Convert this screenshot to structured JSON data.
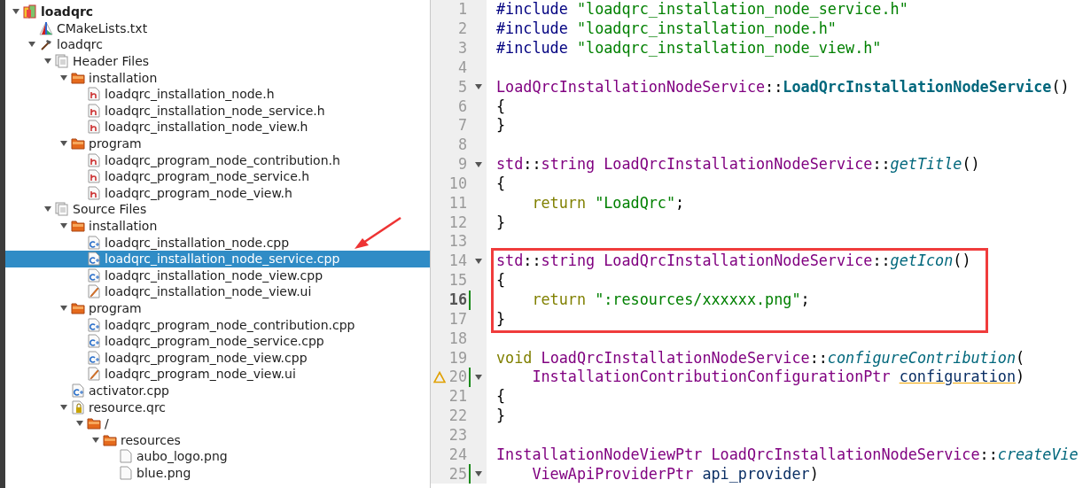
{
  "project_tree": {
    "items": [
      {
        "label": "loadqrc",
        "kind": "project",
        "bold": true,
        "expanded": true,
        "selected": false,
        "children": [
          {
            "label": "CMakeLists.txt",
            "kind": "cmake",
            "selected": false
          },
          {
            "label": "loadqrc",
            "kind": "build",
            "expanded": true,
            "selected": false,
            "children": [
              {
                "label": "Header Files",
                "kind": "group",
                "expanded": true,
                "selected": false,
                "children": [
                  {
                    "label": "installation",
                    "kind": "folder",
                    "expanded": true,
                    "selected": false,
                    "children": [
                      {
                        "label": "loadqrc_installation_node.h",
                        "kind": "header",
                        "selected": false
                      },
                      {
                        "label": "loadqrc_installation_node_service.h",
                        "kind": "header",
                        "selected": false
                      },
                      {
                        "label": "loadqrc_installation_node_view.h",
                        "kind": "header",
                        "selected": false
                      }
                    ]
                  },
                  {
                    "label": "program",
                    "kind": "folder",
                    "expanded": true,
                    "selected": false,
                    "children": [
                      {
                        "label": "loadqrc_program_node_contribution.h",
                        "kind": "header",
                        "selected": false
                      },
                      {
                        "label": "loadqrc_program_node_service.h",
                        "kind": "header",
                        "selected": false
                      },
                      {
                        "label": "loadqrc_program_node_view.h",
                        "kind": "header",
                        "selected": false
                      }
                    ]
                  }
                ]
              },
              {
                "label": "Source Files",
                "kind": "group",
                "expanded": true,
                "selected": false,
                "children": [
                  {
                    "label": "installation",
                    "kind": "folder",
                    "expanded": true,
                    "selected": false,
                    "children": [
                      {
                        "label": "loadqrc_installation_node.cpp",
                        "kind": "source",
                        "selected": false
                      },
                      {
                        "label": "loadqrc_installation_node_service.cpp",
                        "kind": "source",
                        "selected": true
                      },
                      {
                        "label": "loadqrc_installation_node_view.cpp",
                        "kind": "source",
                        "selected": false
                      },
                      {
                        "label": "loadqrc_installation_node_view.ui",
                        "kind": "form",
                        "selected": false
                      }
                    ]
                  },
                  {
                    "label": "program",
                    "kind": "folder",
                    "expanded": true,
                    "selected": false,
                    "children": [
                      {
                        "label": "loadqrc_program_node_contribution.cpp",
                        "kind": "source",
                        "selected": false
                      },
                      {
                        "label": "loadqrc_program_node_service.cpp",
                        "kind": "source",
                        "selected": false
                      },
                      {
                        "label": "loadqrc_program_node_view.cpp",
                        "kind": "source",
                        "selected": false
                      },
                      {
                        "label": "loadqrc_program_node_view.ui",
                        "kind": "form",
                        "selected": false
                      }
                    ]
                  },
                  {
                    "label": "activator.cpp",
                    "kind": "source",
                    "selected": false
                  },
                  {
                    "label": "resource.qrc",
                    "kind": "qrc",
                    "expanded": true,
                    "selected": false,
                    "children": [
                      {
                        "label": "/",
                        "kind": "folder",
                        "expanded": true,
                        "selected": false,
                        "children": [
                          {
                            "label": "resources",
                            "kind": "folder",
                            "expanded": true,
                            "selected": false,
                            "children": [
                              {
                                "label": "aubo_logo.png",
                                "kind": "file",
                                "selected": false
                              },
                              {
                                "label": "blue.png",
                                "kind": "file",
                                "selected": false
                              }
                            ]
                          }
                        ]
                      }
                    ]
                  }
                ]
              }
            ]
          }
        ]
      }
    ]
  },
  "editor": {
    "lines": [
      {
        "number": "1",
        "tokens": [
          {
            "text": "#include ",
            "kind": "preproc"
          },
          {
            "text": "\"loadqrc_installation_node_service.h\"",
            "kind": "string"
          }
        ]
      },
      {
        "number": "2",
        "tokens": [
          {
            "text": "#include ",
            "kind": "preproc"
          },
          {
            "text": "\"loadqrc_installation_node.h\"",
            "kind": "string"
          }
        ]
      },
      {
        "number": "3",
        "tokens": [
          {
            "text": "#include ",
            "kind": "preproc"
          },
          {
            "text": "\"loadqrc_installation_node_view.h\"",
            "kind": "string"
          }
        ]
      },
      {
        "number": "4"
      },
      {
        "number": "5",
        "foldable": true,
        "tokens": [
          {
            "text": "LoadQrcInstallationNodeService",
            "kind": "type"
          },
          {
            "text": "::",
            "kind": "plain"
          },
          {
            "text": "LoadQrcInstallationNodeService",
            "kind": "declaration"
          },
          {
            "text": "()",
            "kind": "plain"
          }
        ]
      },
      {
        "number": "6",
        "tokens": [
          {
            "text": "{",
            "kind": "plain"
          }
        ]
      },
      {
        "number": "7",
        "tokens": [
          {
            "text": "}",
            "kind": "plain"
          }
        ]
      },
      {
        "number": "8"
      },
      {
        "number": "9",
        "foldable": true,
        "tokens": [
          {
            "text": "std",
            "kind": "type"
          },
          {
            "text": "::",
            "kind": "plain"
          },
          {
            "text": "string ",
            "kind": "type"
          },
          {
            "text": "LoadQrcInstallationNodeService",
            "kind": "type"
          },
          {
            "text": "::",
            "kind": "plain"
          },
          {
            "text": "getTitle",
            "kind": "function"
          },
          {
            "text": "()",
            "kind": "plain"
          }
        ]
      },
      {
        "number": "10",
        "tokens": [
          {
            "text": "{",
            "kind": "plain"
          }
        ]
      },
      {
        "number": "11",
        "tokens": [
          {
            "text": "    return ",
            "kind": "keyword"
          },
          {
            "text": "\"LoadQrc\"",
            "kind": "string"
          },
          {
            "text": ";",
            "kind": "plain"
          }
        ]
      },
      {
        "number": "12",
        "tokens": [
          {
            "text": "}",
            "kind": "plain"
          }
        ]
      },
      {
        "number": "13"
      },
      {
        "number": "14",
        "foldable": true,
        "boxed": true,
        "tokens": [
          {
            "text": "std",
            "kind": "type"
          },
          {
            "text": "::",
            "kind": "plain"
          },
          {
            "text": "string ",
            "kind": "type"
          },
          {
            "text": "LoadQrcInstallationNodeService",
            "kind": "type"
          },
          {
            "text": "::",
            "kind": "plain"
          },
          {
            "text": "getIcon",
            "kind": "function"
          },
          {
            "text": "()",
            "kind": "plain"
          }
        ]
      },
      {
        "number": "15",
        "boxed": true,
        "tokens": [
          {
            "text": "{",
            "kind": "plain"
          }
        ]
      },
      {
        "number": "16",
        "boxed": true,
        "current": true,
        "changed": true,
        "tokens": [
          {
            "text": "    return ",
            "kind": "keyword"
          },
          {
            "text": "\":resources/xxxxxx.png\"",
            "kind": "string"
          },
          {
            "text": ";",
            "kind": "plain"
          }
        ]
      },
      {
        "number": "17",
        "boxed": true,
        "tokens": [
          {
            "text": "}",
            "kind": "plain"
          }
        ]
      },
      {
        "number": "18"
      },
      {
        "number": "19",
        "tokens": [
          {
            "text": "void ",
            "kind": "keyword"
          },
          {
            "text": "LoadQrcInstallationNodeService",
            "kind": "type"
          },
          {
            "text": "::",
            "kind": "plain"
          },
          {
            "text": "configureContribution",
            "kind": "function"
          },
          {
            "text": "(",
            "kind": "plain"
          }
        ]
      },
      {
        "number": "20",
        "foldable": true,
        "changed": true,
        "warning": true,
        "tokens": [
          {
            "text": "    InstallationContributionConfigurationPtr ",
            "kind": "type"
          },
          {
            "text": "configuration",
            "kind": "unused"
          },
          {
            "text": ")",
            "kind": "plain"
          }
        ]
      },
      {
        "number": "21",
        "tokens": [
          {
            "text": "{",
            "kind": "plain"
          }
        ]
      },
      {
        "number": "22",
        "tokens": [
          {
            "text": "}",
            "kind": "plain"
          }
        ]
      },
      {
        "number": "23"
      },
      {
        "number": "24",
        "tokens": [
          {
            "text": "InstallationNodeViewPtr LoadQrcInstallationNodeService",
            "kind": "type"
          },
          {
            "text": "::",
            "kind": "plain"
          },
          {
            "text": "createVie",
            "kind": "function"
          }
        ]
      },
      {
        "number": "25",
        "foldable": true,
        "changed": true,
        "tokens": [
          {
            "text": "    ViewApiProviderPtr ",
            "kind": "type"
          },
          {
            "text": "api_provider",
            "kind": "param"
          },
          {
            "text": ")",
            "kind": "plain"
          }
        ]
      }
    ]
  }
}
